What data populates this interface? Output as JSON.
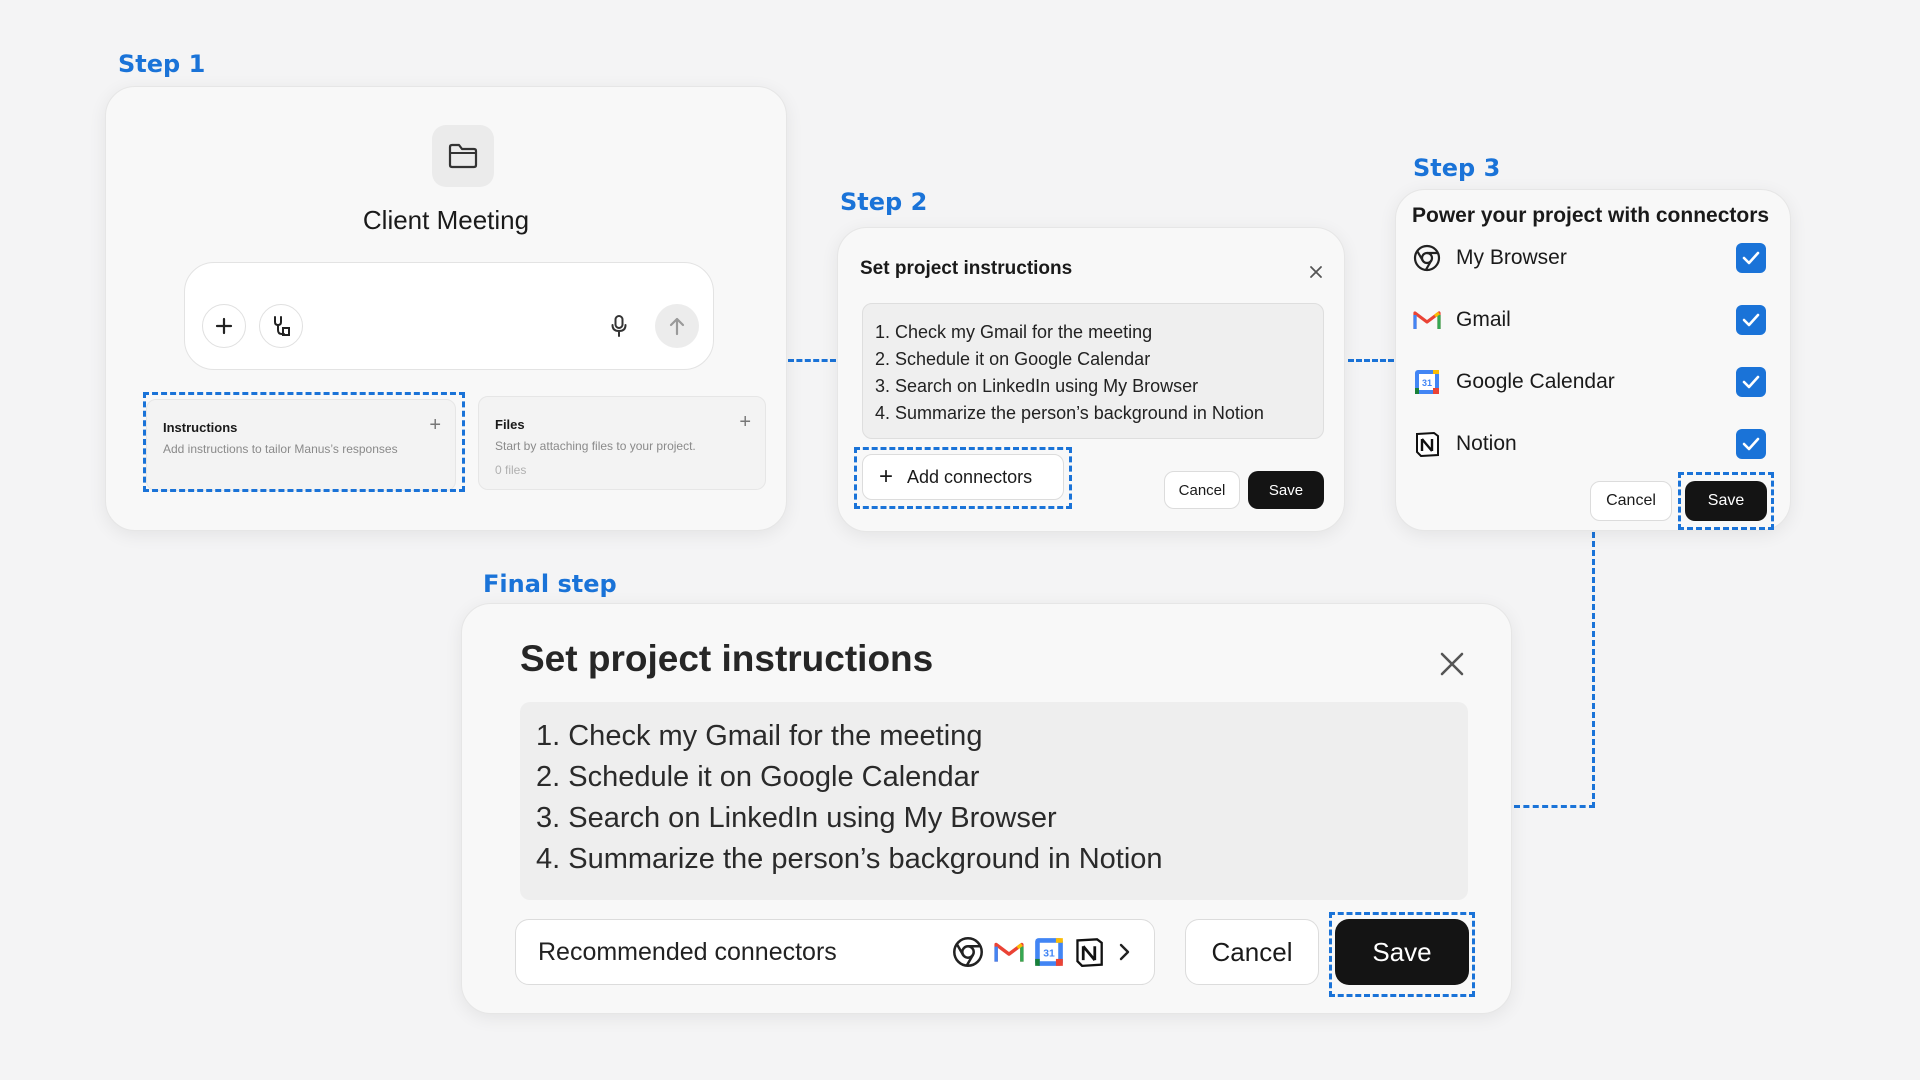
{
  "step1": {
    "label": "Step 1",
    "project_title": "Client Meeting",
    "instructions_card": {
      "title": "Instructions",
      "desc": "Add instructions to tailor Manus’s responses"
    },
    "files_card": {
      "title": "Files",
      "desc": "Start by attaching files to your project.",
      "count": "0 files"
    }
  },
  "step2": {
    "label": "Step 2",
    "title": "Set project instructions",
    "instructions": [
      "1. Check my Gmail for the meeting",
      "2. Schedule it on Google Calendar",
      "3. Search on LinkedIn using My Browser",
      "4. Summarize the person’s background in Notion"
    ],
    "add_connectors_label": "Add connectors",
    "cancel_label": "Cancel",
    "save_label": "Save"
  },
  "step3": {
    "label": "Step 3",
    "title": "Power your project with connectors",
    "connectors": [
      {
        "name": "My Browser",
        "icon": "chrome-icon",
        "checked": true
      },
      {
        "name": "Gmail",
        "icon": "gmail-icon",
        "checked": true
      },
      {
        "name": "Google Calendar",
        "icon": "google-calendar-icon",
        "checked": true
      },
      {
        "name": "Notion",
        "icon": "notion-icon",
        "checked": true
      }
    ],
    "cancel_label": "Cancel",
    "save_label": "Save"
  },
  "final": {
    "label": "Final step",
    "title": "Set project instructions",
    "instructions": [
      "1. Check my Gmail for the meeting",
      "2. Schedule it on Google Calendar",
      "3. Search on LinkedIn using My Browser",
      "4. Summarize the person’s background in Notion"
    ],
    "recommended_label": "Recommended connectors",
    "calendar_day": "31",
    "cancel_label": "Cancel",
    "save_label": "Save"
  },
  "colors": {
    "accent": "#1a73d8",
    "dark_button": "#141414",
    "gmail_red": "#ea4335"
  }
}
